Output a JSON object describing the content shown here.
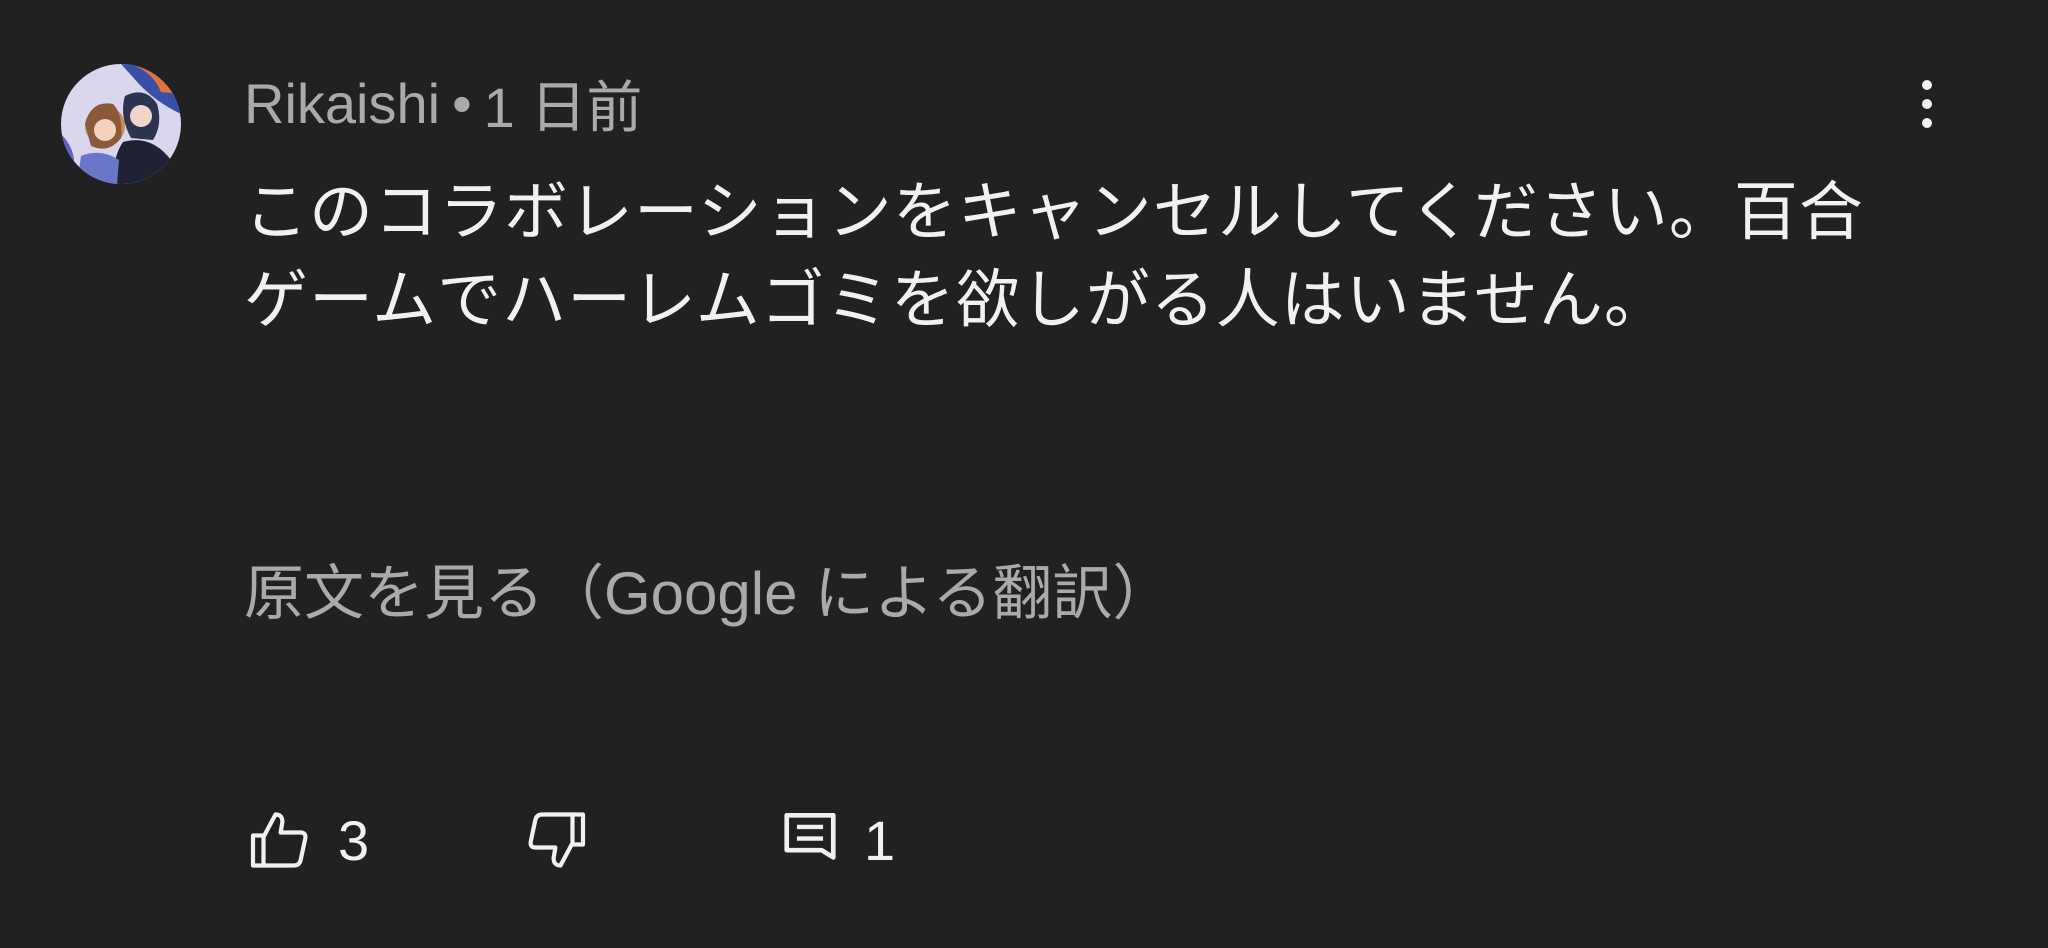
{
  "comment": {
    "author": "Rikaishi",
    "separator": "•",
    "timestamp": "1 日前",
    "text": "このコラボレーションをキャンセルしてください。百合ゲームでハーレムゴミを欲しがる人はいません。",
    "translate_link": "原文を見る（Google による翻訳）",
    "actions": {
      "likes": "3",
      "replies": "1"
    }
  },
  "icons": {
    "menu": "more-vertical-icon",
    "like": "thumbs-up-icon",
    "dislike": "thumbs-down-icon",
    "reply": "comment-reply-icon"
  },
  "colors": {
    "background": "#212121",
    "primary_text": "#f1f1f1",
    "secondary_text": "#aaaaaa"
  }
}
